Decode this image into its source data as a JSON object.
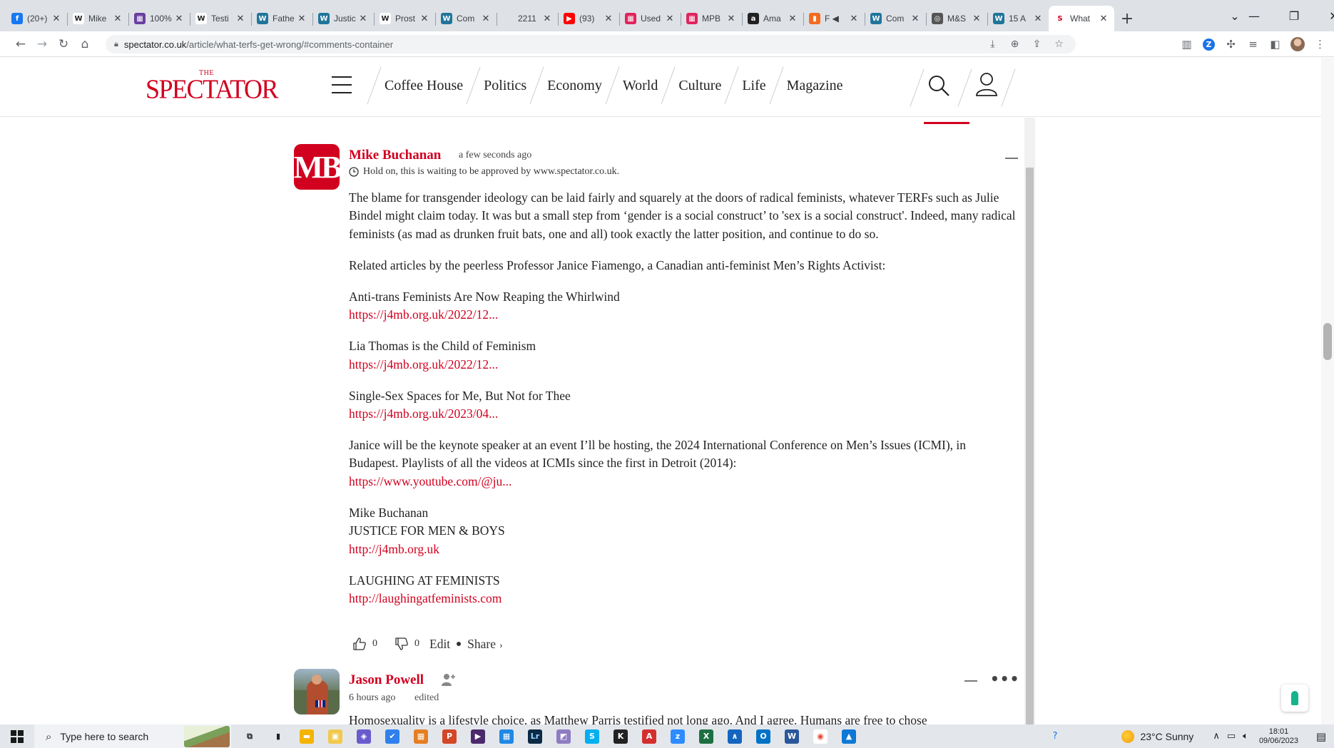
{
  "browser": {
    "tabs": [
      {
        "favicon": "f",
        "favicon_bg": "#1877f2",
        "title": "(20+)"
      },
      {
        "favicon": "W",
        "favicon_bg": "#ffffff",
        "title": "Mike"
      },
      {
        "favicon": "▦",
        "favicon_bg": "#6a3fa0",
        "title": "100%"
      },
      {
        "favicon": "W",
        "favicon_bg": "#ffffff",
        "title": "Testi"
      },
      {
        "favicon": "W",
        "favicon_bg": "#21759b",
        "title": "Fathe"
      },
      {
        "favicon": "W",
        "favicon_bg": "#21759b",
        "title": "Justic"
      },
      {
        "favicon": "W",
        "favicon_bg": "#ffffff",
        "title": "Prost"
      },
      {
        "favicon": "W",
        "favicon_bg": "#21759b",
        "title": "Com"
      },
      {
        "favicon": "",
        "favicon_bg": "#dee1e6",
        "title": "2211"
      },
      {
        "favicon": "▶",
        "favicon_bg": "#ff0000",
        "title": "(93)"
      },
      {
        "favicon": "▦",
        "favicon_bg": "#e0245e",
        "title": "Used"
      },
      {
        "favicon": "▦",
        "favicon_bg": "#e0245e",
        "title": "MPB"
      },
      {
        "favicon": "a",
        "favicon_bg": "#222222",
        "title": "Ama"
      },
      {
        "favicon": "▮",
        "favicon_bg": "#f36c21",
        "title": "F ◀"
      },
      {
        "favicon": "W",
        "favicon_bg": "#21759b",
        "title": "Com"
      },
      {
        "favicon": "◎",
        "favicon_bg": "#555555",
        "title": "M&S"
      },
      {
        "favicon": "W",
        "favicon_bg": "#21759b",
        "title": "15 A"
      },
      {
        "favicon": "S",
        "favicon_bg": "#ffffff",
        "title": "What"
      }
    ],
    "close_glyph": "✕",
    "new_tab_glyph": "+",
    "url_host": "spectator.co.uk",
    "url_path": "/article/what-terfs-get-wrong/#comments-container"
  },
  "site": {
    "logo_the": "THE",
    "logo_word": "SPECTATOR",
    "nav": [
      "Coffee House",
      "Politics",
      "Economy",
      "World",
      "Culture",
      "Life",
      "Magazine"
    ]
  },
  "comment1": {
    "avatar_initials": "MB",
    "author": "Mike Buchanan",
    "time": "a few seconds ago",
    "pending": "Hold on, this is waiting to be approved by www.spectator.co.uk.",
    "paragraphs": [
      {
        "text": "The blame for transgender ideology can be laid fairly and squarely at the doors of radical feminists, whatever TERFs such as Julie Bindel might claim today. It was but a small step from ‘gender is a social construct’ to 'sex is a social construct'. Indeed, many radical feminists (as mad as drunken fruit bats, one and all) took exactly the latter position, and continue to do so."
      },
      {
        "text": "Related articles by the peerless Professor Janice Fiamengo, a Canadian anti-feminist Men’s Rights Activist:"
      },
      {
        "text": "Anti-trans Feminists Are Now Reaping the Whirlwind",
        "link": "https://j4mb.org.uk/2022/12..."
      },
      {
        "text": "Lia Thomas is the Child of Feminism",
        "link": "https://j4mb.org.uk/2022/12..."
      },
      {
        "text": "Single-Sex Spaces for Me, But Not for Thee",
        "link": "https://j4mb.org.uk/2023/04..."
      },
      {
        "text": "Janice will be the keynote speaker at an event I’ll be hosting, the 2024 International Conference on Men’s Issues (ICMI), in Budapest. Playlists of all the videos at ICMIs since the first in Detroit (2014):",
        "link": "https://www.youtube.com/@ju..."
      },
      {
        "text": "Mike Buchanan",
        "text2": "JUSTICE FOR MEN & BOYS",
        "link": "http://j4mb.org.uk"
      },
      {
        "text": "LAUGHING AT FEMINISTS",
        "link": "http://laughingatfeminists.com"
      }
    ],
    "upvotes": "0",
    "downvotes": "0",
    "edit_label": "Edit",
    "share_label": "Share",
    "share_chevron": "›"
  },
  "comment2": {
    "author": "Jason Powell",
    "time": "6 hours ago",
    "edited": "edited",
    "more_glyph": "•••",
    "body": "Homosexuality is a lifestyle choice, as Matthew Parris testified not long ago. And I agree. Humans are free to chose"
  },
  "taskbar": {
    "search_placeholder": "Type here to search",
    "weather": "23°C  Sunny",
    "time": "18:01",
    "date": "09/06/2023",
    "apps": [
      {
        "glyph": "⧉",
        "bg": "#e3e7ec",
        "fg": "#222222"
      },
      {
        "glyph": "▮",
        "bg": "#e3e7ec",
        "fg": "#222222"
      },
      {
        "glyph": "▬",
        "bg": "#f4b400",
        "fg": "#ffffff"
      },
      {
        "glyph": "▣",
        "bg": "#f2c94c",
        "fg": "#ffffff"
      },
      {
        "glyph": "◈",
        "bg": "#6a5acd",
        "fg": "#ffffff"
      },
      {
        "glyph": "✔",
        "bg": "#2f80ed",
        "fg": "#ffffff"
      },
      {
        "glyph": "▦",
        "bg": "#e67e22",
        "fg": "#ffffff"
      },
      {
        "glyph": "P",
        "bg": "#d24726",
        "fg": "#ffffff"
      },
      {
        "glyph": "▶",
        "bg": "#4b2a6b",
        "fg": "#ffffff"
      },
      {
        "glyph": "▦",
        "bg": "#1e88e5",
        "fg": "#ffffff"
      },
      {
        "glyph": "Lr",
        "bg": "#0b2a45",
        "fg": "#9fd3ff"
      },
      {
        "glyph": "◩",
        "bg": "#8e7cc3",
        "fg": "#ffffff"
      },
      {
        "glyph": "S",
        "bg": "#00aff0",
        "fg": "#ffffff"
      },
      {
        "glyph": "K",
        "bg": "#222222",
        "fg": "#ffffff"
      },
      {
        "glyph": "A",
        "bg": "#d32f2f",
        "fg": "#ffffff"
      },
      {
        "glyph": "z",
        "bg": "#2d8cff",
        "fg": "#ffffff"
      },
      {
        "glyph": "X",
        "bg": "#1d6f42",
        "fg": "#ffffff"
      },
      {
        "glyph": "∧",
        "bg": "#1565c0",
        "fg": "#ffffff"
      },
      {
        "glyph": "O",
        "bg": "#0072c6",
        "fg": "#ffffff"
      },
      {
        "glyph": "W",
        "bg": "#2b579a",
        "fg": "#ffffff"
      },
      {
        "glyph": "◉",
        "bg": "#ffffff",
        "fg": "#ea4335"
      },
      {
        "glyph": "▲",
        "bg": "#0e78d5",
        "fg": "#ffffff"
      }
    ]
  }
}
